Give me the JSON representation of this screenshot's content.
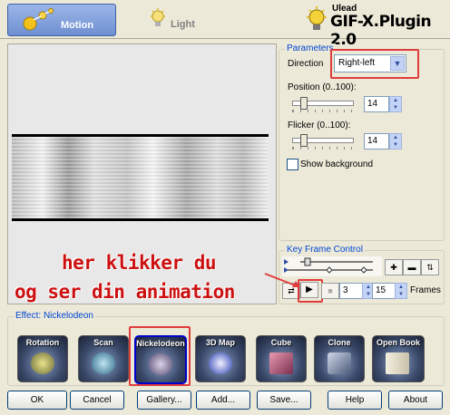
{
  "tabs": {
    "motion": "Motion",
    "light": "Light"
  },
  "brand": {
    "vendor": "Ulead",
    "product": "GIF-X.Plugin 2.0"
  },
  "parameters": {
    "title": "Parameters",
    "direction_label": "Direction",
    "direction_value": "Right-left",
    "position_label": "Position (0..100):",
    "position_value": "14",
    "flicker_label": "Flicker (0..100):",
    "flicker_value": "14",
    "show_background_label": "Show background"
  },
  "key_frame_control": {
    "title": "Key Frame Control",
    "current_frame": "3",
    "separator": "/",
    "total_frames": "15",
    "frames_label": "Frames"
  },
  "annotation": {
    "line1": "her klikker du",
    "line2": "og ser din animation",
    "color": "#cc1010"
  },
  "effect": {
    "title": "Effect: Nickelodeon",
    "items": [
      "Rotation",
      "Scan",
      "Nickelodeon",
      "3D Map",
      "Cube",
      "Clone",
      "Open Book"
    ],
    "selected": "Nickelodeon"
  },
  "buttons": {
    "ok": "OK",
    "cancel": "Cancel",
    "gallery": "Gallery...",
    "add": "Add...",
    "save": "Save...",
    "help": "Help",
    "about": "About"
  },
  "colors": {
    "accent": "#0046d5",
    "highlight_red": "#e03b3b"
  }
}
